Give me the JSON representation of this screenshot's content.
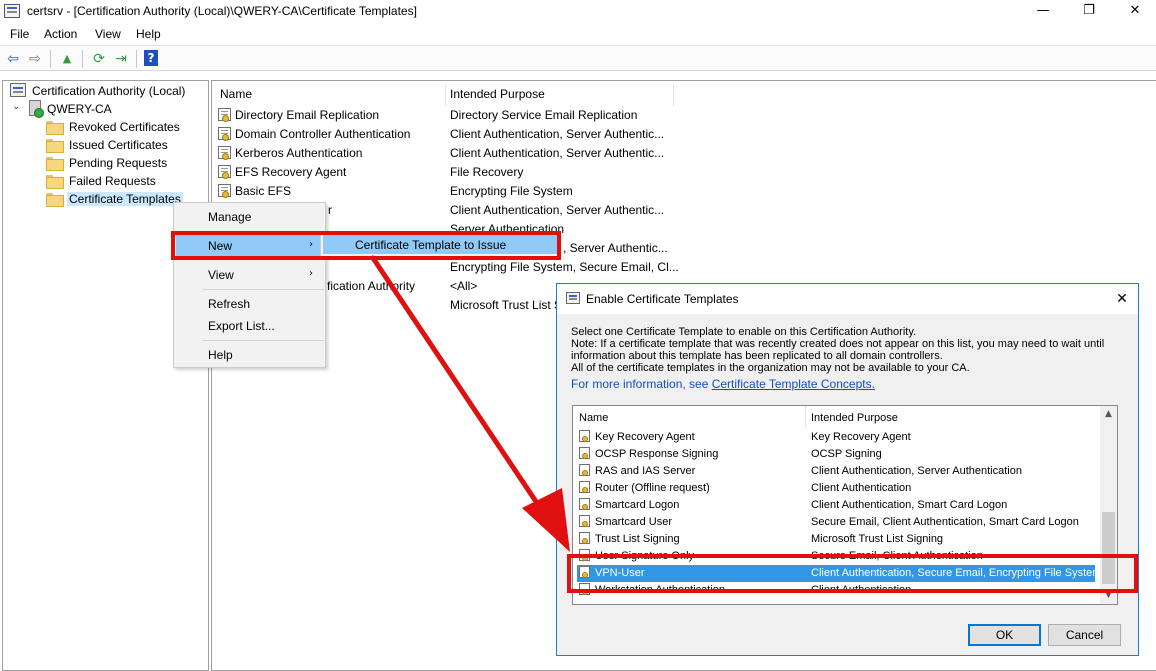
{
  "window": {
    "title": "certsrv - [Certification Authority (Local)\\QWERY-CA\\Certificate Templates]",
    "minimize": "—",
    "restore": "❐",
    "close": "✕"
  },
  "menu": [
    "File",
    "Action",
    "View",
    "Help"
  ],
  "toolbar": {
    "back": "⇦",
    "forward": "⇨",
    "up": "▲",
    "refresh": "⟳",
    "export": "⇥",
    "help": "?"
  },
  "tree": {
    "root": "Certification Authority (Local)",
    "ca": "QWERY-CA",
    "expand_glyph": "⌄",
    "children": [
      "Revoked Certificates",
      "Issued Certificates",
      "Pending Requests",
      "Failed Requests",
      "Certificate Templates"
    ]
  },
  "list": {
    "columns": [
      "Name",
      "Intended Purpose"
    ],
    "rows": [
      {
        "name": "Directory Email Replication",
        "purpose": "Directory Service Email Replication"
      },
      {
        "name": "Domain Controller Authentication",
        "purpose": "Client Authentication, Server Authentic..."
      },
      {
        "name": "Kerberos Authentication",
        "purpose": "Client Authentication, Server Authentic..."
      },
      {
        "name": "EFS Recovery Agent",
        "purpose": "File Recovery"
      },
      {
        "name": "Basic EFS",
        "purpose": "Encrypting File System"
      },
      {
        "name": "r",
        "purpose": "Client Authentication, Server Authentic..."
      },
      {
        "name": "",
        "purpose": "Server Authentication"
      },
      {
        "name": "",
        "purpose": ", Server Authentic..."
      },
      {
        "name": "",
        "purpose": "Encrypting File System, Secure Email, Cl..."
      },
      {
        "name": "fication Authority",
        "purpose": "<All>"
      },
      {
        "name": "",
        "purpose": "Microsoft Trust List S"
      }
    ]
  },
  "context_menu": {
    "items": [
      "Manage",
      "New",
      "View",
      "Refresh",
      "Export List...",
      "Help"
    ],
    "arrow": "›",
    "submenu_item": "Certificate Template to Issue"
  },
  "dialog": {
    "title": "Enable Certificate Templates",
    "close": "✕",
    "description": [
      "Select one Certificate Template to enable on this Certification Authority.",
      "Note: If a certificate template that was recently created does not appear on this list, you may need to wait until",
      "information about this template has been replicated to all domain controllers.",
      "All of the certificate templates in the organization may not be available to your CA."
    ],
    "more_info_prefix": "For more information, see ",
    "more_info_link": "Certificate Template Concepts.",
    "columns": [
      "Name",
      "Intended Purpose"
    ],
    "rows": [
      {
        "name": "Key Recovery Agent",
        "purpose": "Key Recovery Agent"
      },
      {
        "name": "OCSP Response Signing",
        "purpose": "OCSP Signing"
      },
      {
        "name": "RAS and IAS Server",
        "purpose": "Client Authentication, Server Authentication"
      },
      {
        "name": "Router (Offline request)",
        "purpose": "Client Authentication"
      },
      {
        "name": "Smartcard Logon",
        "purpose": "Client Authentication, Smart Card Logon"
      },
      {
        "name": "Smartcard User",
        "purpose": "Secure Email, Client Authentication, Smart Card Logon"
      },
      {
        "name": "Trust List Signing",
        "purpose": "Microsoft Trust List Signing"
      },
      {
        "name": "User Signature Only",
        "purpose": "Secure Email, Client Authentication"
      },
      {
        "name": "VPN-User",
        "purpose": "Client Authentication, Secure Email, Encrypting File System"
      },
      {
        "name": "Workstation Authentication",
        "purpose": "Client Authentication"
      }
    ],
    "selected_index": 8,
    "scroll_up": "▲",
    "scroll_down": "▼",
    "ok": "OK",
    "cancel": "Cancel"
  },
  "colors": {
    "annotation": "#e01010",
    "selection": "#3296e6",
    "menu_highlight": "#91c9f7"
  }
}
